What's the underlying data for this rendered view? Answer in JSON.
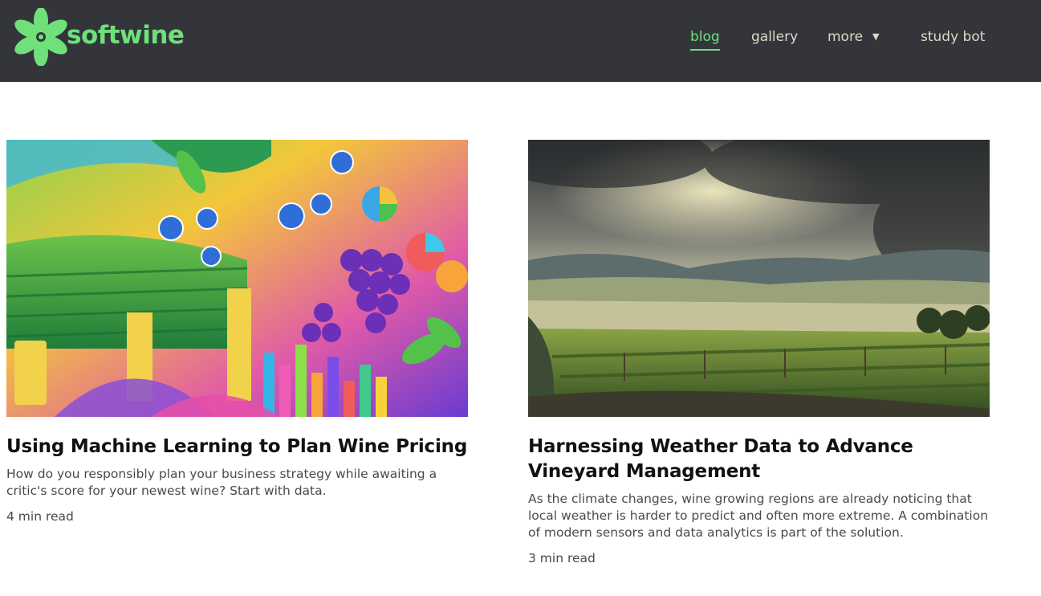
{
  "brand": {
    "name": "softwine",
    "logo_icon": "flower-logo-icon",
    "accent_color": "#6fe07a",
    "header_bg": "#34353b"
  },
  "nav": {
    "items": [
      {
        "label": "blog",
        "active": true
      },
      {
        "label": "gallery",
        "active": false
      },
      {
        "label": "more",
        "active": false,
        "dropdown": true
      },
      {
        "label": "study bot",
        "active": false
      }
    ],
    "dropdown_icon": "caret-down-icon"
  },
  "posts": [
    {
      "title": "Using Machine Learning to Plan Wine Pricing",
      "description": "How do you responsibly plan your business strategy while awaiting a critic's score for your newest wine? Start with data.",
      "read_time": "4 min read"
    },
    {
      "title": "Harnessing Weather Data to Advance Vineyard Management",
      "description": "As the climate changes, wine growing regions are already noticing that local weather is harder to predict and often more extreme. A combination of modern sensors and data analytics is part of the solution.",
      "read_time": "3 min read"
    }
  ]
}
